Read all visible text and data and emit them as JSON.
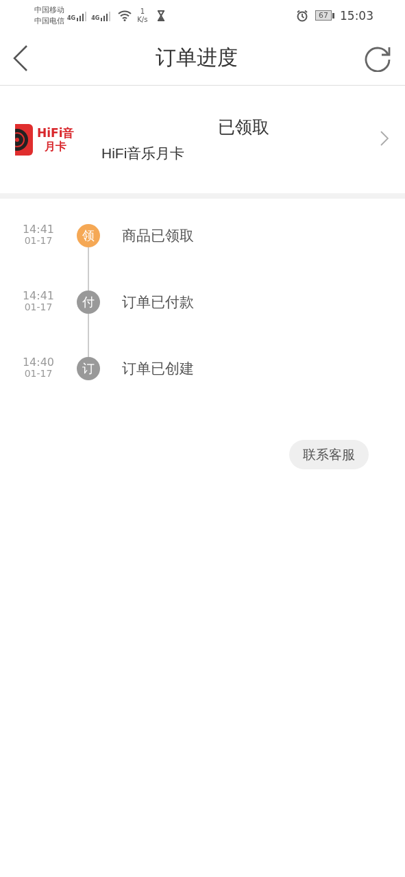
{
  "status_bar": {
    "carriers": [
      "中国移动",
      "中国电信"
    ],
    "network_1": "4G",
    "network_2": "4G",
    "speed_value": "1",
    "speed_unit": "K/s",
    "battery": "67",
    "time": "15:03"
  },
  "header": {
    "title": "订单进度"
  },
  "product": {
    "logo_top": "HiFi音",
    "logo_bottom": "月卡",
    "status": "已领取",
    "name": "HiFi音乐月卡"
  },
  "timeline": [
    {
      "time": "14:41",
      "date": "01-17",
      "badge": "领",
      "label": "商品已领取",
      "color": "#f5a855"
    },
    {
      "time": "14:41",
      "date": "01-17",
      "badge": "付",
      "label": "订单已付款",
      "color": "#999999"
    },
    {
      "time": "14:40",
      "date": "01-17",
      "badge": "订",
      "label": "订单已创建",
      "color": "#999999"
    }
  ],
  "contact_button": "联系客服"
}
